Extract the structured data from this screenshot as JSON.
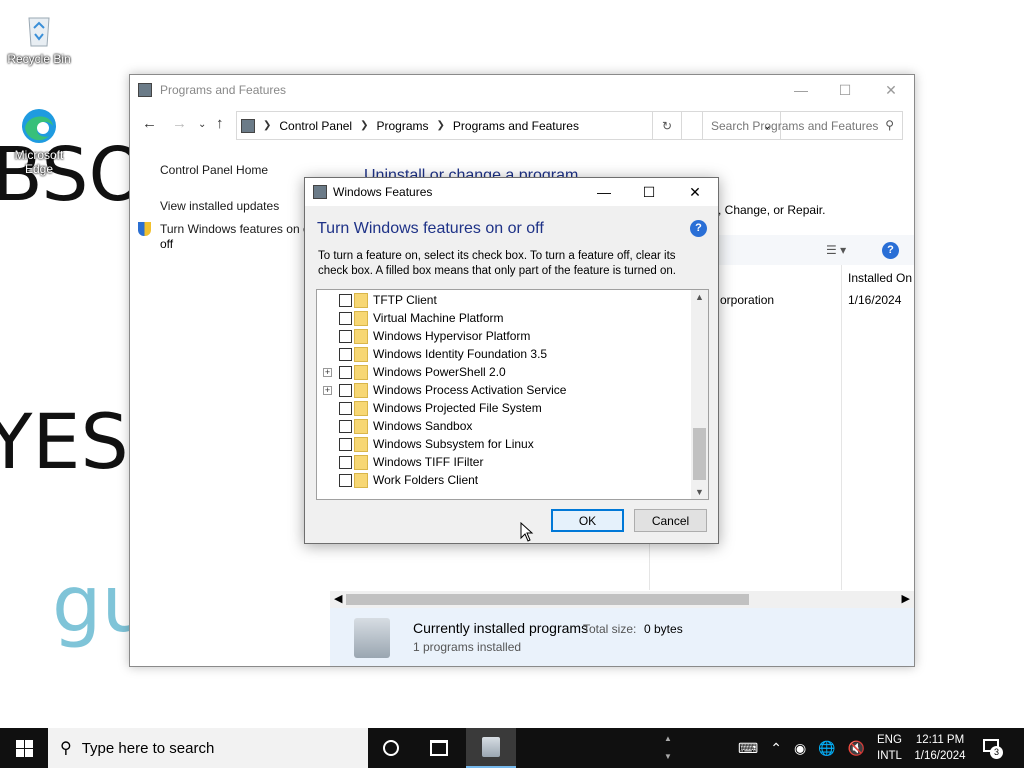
{
  "desktop": {
    "bg_text_1": "BSO",
    "bg_text_2": "YES I",
    "bg_text_3": "gu",
    "icons": [
      {
        "label": "Recycle Bin",
        "icon": "recycle-bin-icon"
      },
      {
        "label": "Microsoft Edge",
        "icon": "edge-icon"
      }
    ]
  },
  "programs_window": {
    "title": "Programs and Features",
    "breadcrumb": [
      "Control Panel",
      "Programs",
      "Programs and Features"
    ],
    "search_placeholder": "Search Programs and Features",
    "sidebar": [
      "Control Panel Home",
      "View installed updates",
      "Turn Windows features on or off"
    ],
    "heading": "Uninstall or change a program",
    "subtext": ", Change, or Repair.",
    "column_installed_on": "Installed On",
    "row_publisher_fragment": "orporation",
    "row_installed_on": "1/16/2024",
    "status_title": "Currently installed programs",
    "status_total_label": "Total size:",
    "status_total_value": "0 bytes",
    "status_count": "1 programs installed"
  },
  "dialog": {
    "title": "Windows Features",
    "heading": "Turn Windows features on or off",
    "description": "To turn a feature on, select its check box. To turn a feature off, clear its check box. A filled box means that only part of the feature is turned on.",
    "features": [
      {
        "label": "TFTP Client",
        "expandable": false,
        "checked": false
      },
      {
        "label": "Virtual Machine Platform",
        "expandable": false,
        "checked": false
      },
      {
        "label": "Windows Hypervisor Platform",
        "expandable": false,
        "checked": false
      },
      {
        "label": "Windows Identity Foundation 3.5",
        "expandable": false,
        "checked": false
      },
      {
        "label": "Windows PowerShell 2.0",
        "expandable": true,
        "checked": false
      },
      {
        "label": "Windows Process Activation Service",
        "expandable": true,
        "checked": false
      },
      {
        "label": "Windows Projected File System",
        "expandable": false,
        "checked": false
      },
      {
        "label": "Windows Sandbox",
        "expandable": false,
        "checked": false
      },
      {
        "label": "Windows Subsystem for Linux",
        "expandable": false,
        "checked": false
      },
      {
        "label": "Windows TIFF IFilter",
        "expandable": false,
        "checked": false
      },
      {
        "label": "Work Folders Client",
        "expandable": false,
        "checked": false
      }
    ],
    "ok_label": "OK",
    "cancel_label": "Cancel"
  },
  "taskbar": {
    "search_placeholder": "Type here to search",
    "lang_1": "ENG",
    "lang_2": "INTL",
    "time": "12:11 PM",
    "date": "1/16/2024",
    "notification_count": "3"
  }
}
